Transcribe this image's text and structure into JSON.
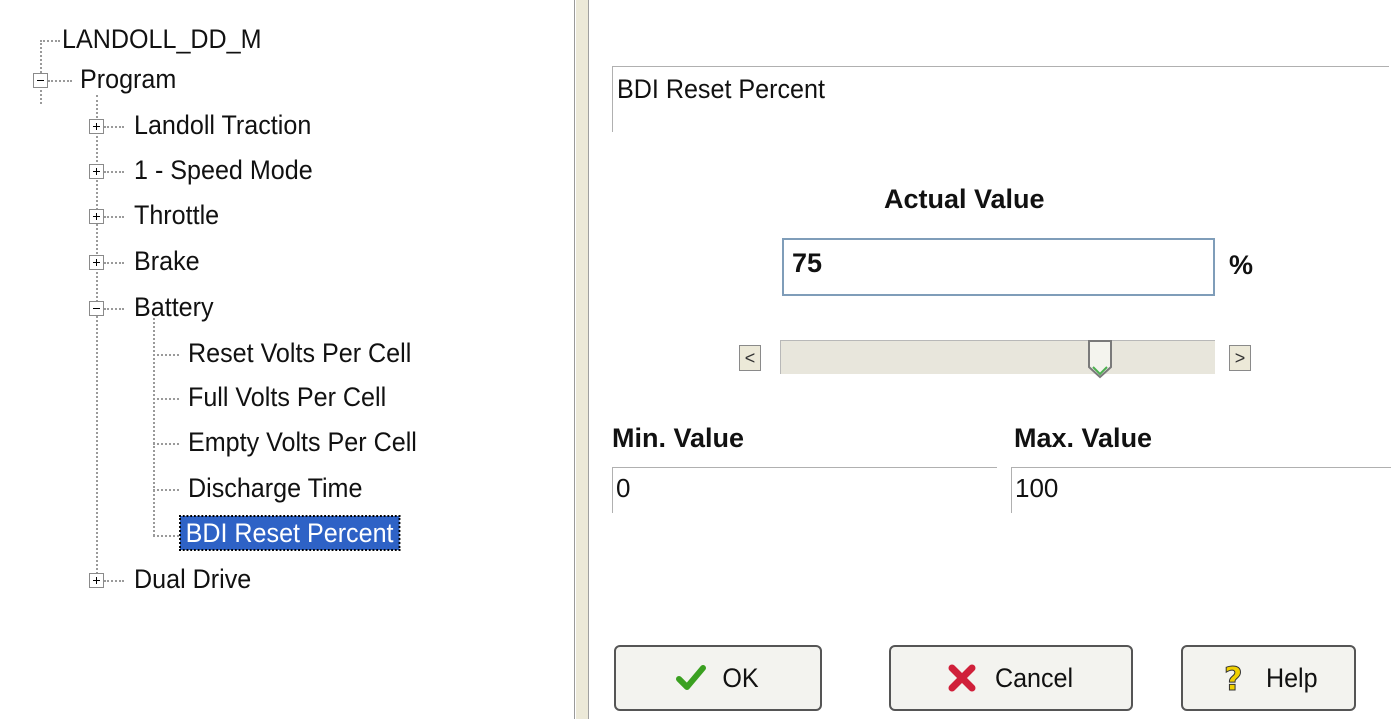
{
  "tree": {
    "root": "LANDOLL_DD_M",
    "program": "Program",
    "items": [
      {
        "label": "Landoll Traction",
        "expanded": false
      },
      {
        "label": "1 - Speed Mode",
        "expanded": false
      },
      {
        "label": "Throttle",
        "expanded": false
      },
      {
        "label": "Brake",
        "expanded": false
      },
      {
        "label": "Battery",
        "expanded": true
      },
      {
        "label": "Dual Drive",
        "expanded": false
      }
    ],
    "battery_children": [
      "Reset Volts Per Cell",
      "Full Volts Per Cell",
      "Empty Volts Per Cell",
      "Discharge Time",
      "BDI Reset Percent"
    ],
    "selected": "BDI Reset Percent"
  },
  "property": {
    "name": "BDI Reset Percent",
    "actual_label": "Actual Value",
    "value": "75",
    "unit": "%",
    "slider_fraction": 0.75,
    "min_label": "Min. Value",
    "max_label": "Max. Value",
    "min_value": "0",
    "max_value": "100",
    "scroll_left_glyph": "<",
    "scroll_right_glyph": ">"
  },
  "buttons": {
    "ok": "OK",
    "cancel": "Cancel",
    "help": "Help"
  },
  "icons": {
    "ok": "checkmark-icon",
    "cancel": "x-mark-icon",
    "help": "question-icon",
    "thumb": "slider-thumb-icon"
  },
  "colors": {
    "selection": "#2e62c6",
    "ok_icon": "#3aa020",
    "cancel_icon": "#d0203a",
    "help_icon": "#f0d000"
  }
}
